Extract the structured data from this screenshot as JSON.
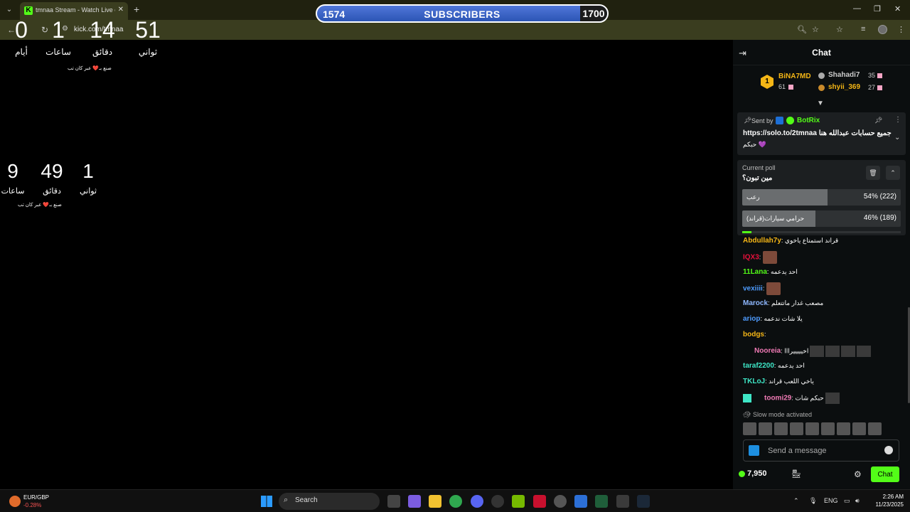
{
  "browser": {
    "tab_title": "tmnaa Stream - Watch Live on Kick",
    "url": "kick.com/tmnaa"
  },
  "subscribers": {
    "current": "1574",
    "label": "SUBSCRIBERS",
    "goal": "1700",
    "progress_fraction": 0.93
  },
  "countdown_main": {
    "days": "0",
    "days_label": "أيام",
    "hours": "1",
    "hours_label": "ساعات",
    "minutes": "14",
    "minutes_label": "دقائق",
    "seconds": "51",
    "seconds_label": "ثواني",
    "credit": "صنع بـ❤️ عبر كان تب"
  },
  "countdown_second": {
    "hours": "9",
    "hours_label": "ساعات",
    "minutes": "49",
    "minutes_label": "دقائق",
    "seconds": "1",
    "seconds_label": "ثواني",
    "credit": "صنع بـ❤️ عبر كان تب"
  },
  "chat": {
    "title": "Chat",
    "leaderboard": {
      "first": {
        "rank": "1",
        "name": "BiNA7MD",
        "count": "61"
      },
      "second": {
        "name": "Shahadi7",
        "count": "35"
      },
      "third": {
        "name": "shyii_369",
        "count": "27"
      }
    },
    "pinned": {
      "sent_by": "Sent by",
      "sender": "BotRix",
      "link": "https://solo.to/2tmnaa",
      "text": "جميع حسابات عبدالله هنا",
      "text2": "حبكم 💜"
    },
    "poll": {
      "label": "Current poll",
      "question": "مين تبون؟",
      "options": [
        {
          "label": "رعب",
          "result": "54% (222)",
          "fraction": 0.54
        },
        {
          "label": "حرامي سيارات(قراند)",
          "result": "46% (189)",
          "fraction": 0.46
        }
      ],
      "time_left_fraction": 0.06
    },
    "messages": [
      {
        "user": "Abdullah7y",
        "color": "#f5b616",
        "text": "قراند استمتاع ياخوي"
      },
      {
        "user": "IQX3",
        "color": "#e9113c",
        "text": ""
      },
      {
        "user": "11Lana",
        "color": "#53fc18",
        "text": "احد يدعمه"
      },
      {
        "user": "vexiiii",
        "color": "#4e9cff",
        "text": ""
      },
      {
        "user": "Marock",
        "color": "#8fb8ff",
        "text": "مصعب غدار ماتتعلم"
      },
      {
        "user": "ariop",
        "color": "#4e9cff",
        "text": "يلا شات ندعمه"
      },
      {
        "user": "bodgs",
        "color": "#f5b616",
        "text": ""
      },
      {
        "user": "Nooreia",
        "color": "#f07ab5",
        "text": "اخيييييرااا"
      },
      {
        "user": "taraf2200",
        "color": "#3ee6c6",
        "text": "احد يدعمه"
      },
      {
        "user": "TKLoJ",
        "color": "#3ee6c6",
        "text": "ياخي اللعب قراند"
      },
      {
        "user": "toomi29",
        "color": "#f07ab5",
        "text": "حبكم شات"
      }
    ],
    "slow_mode": "Slow mode activated",
    "input_placeholder": "Send a message",
    "points": "7,950",
    "send_button": "Chat"
  },
  "taskbar": {
    "fx_pair": "EUR/GBP",
    "fx_change": "-0.28%",
    "search_label": "Search",
    "language": "ENG",
    "time": "2:26 AM",
    "date": "11/23/2025"
  },
  "colors": {
    "kick_green": "#53fc18",
    "sub_bar_blue": "#2c55b5",
    "gold": "#f5b616"
  }
}
